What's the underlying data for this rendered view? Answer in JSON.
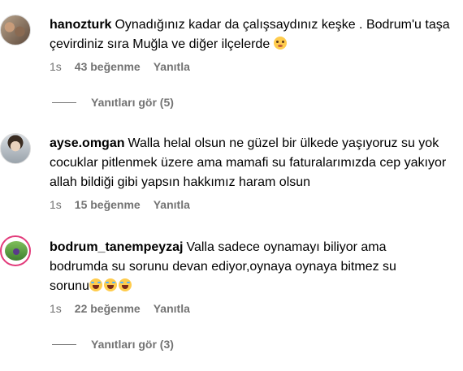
{
  "comments": [
    {
      "username": "hanozturk",
      "text": "Oynadığınız kadar da çalışsaydınız keşke . Bodrum'u taşa çevirdiniz sıra Muğla ve diğer ilçelerde",
      "emoji": "flushed-emoji",
      "time": "1s",
      "likes": "43 beğenme",
      "reply": "Yanıtla",
      "view_replies": "Yanıtları gör (5)"
    },
    {
      "username": "ayse.omgan",
      "text": "Walla helal olsun ne güzel bir ülkede yaşıyoruz su yok cocuklar pitlenmek üzere ama mamafi su faturalarımızda cep yakıyor allah bildiği gibi yapsın hakkımız haram olsun",
      "time": "1s",
      "likes": "15 beğenme",
      "reply": "Yanıtla"
    },
    {
      "username": "bodrum_tanempeyzaj",
      "text": "Valla sadece oynamayı biliyor ama bodrumda su sorunu devan ediyor,oynaya oynaya bitmez su sorunu",
      "emoji": "laughing-emoji",
      "time": "1s",
      "likes": "22 beğenme",
      "reply": "Yanıtla",
      "view_replies": "Yanıtları gör (3)"
    }
  ]
}
